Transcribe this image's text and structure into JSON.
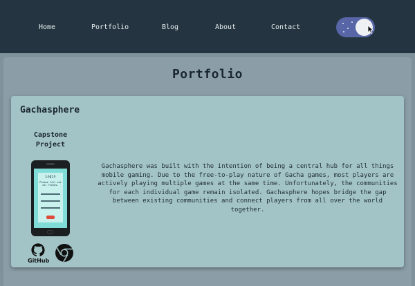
{
  "nav": {
    "items": [
      "Home",
      "Portfolio",
      "Blog",
      "About",
      "Contact"
    ]
  },
  "theme_toggle": {
    "state": "light"
  },
  "page": {
    "title": "Portfolio"
  },
  "project": {
    "title": "Gachasphere",
    "subtitle_line1": "Capstone",
    "subtitle_line2": "Project",
    "description": "Gachasphere was built with the intention of being a central hub for all things mobile gaming. Due to the free-to-play nature of Gacha games, most players are actively playing multiple games at the same time. Unfortunately, the communities for each individual game remain isolated. Gachasphere hopes bridge the gap between existing communities and connect players from all over the world together.",
    "phone_screen": {
      "title": "Login",
      "text": "Please fill out all fields."
    },
    "links": {
      "github_label": "GitHub",
      "github_icon": "github-icon",
      "chrome_icon": "chrome-icon"
    }
  },
  "colors": {
    "navbar": "#243541",
    "background": "#7f929c",
    "card": "#a3c4c6",
    "toggle": "#5866a8"
  }
}
